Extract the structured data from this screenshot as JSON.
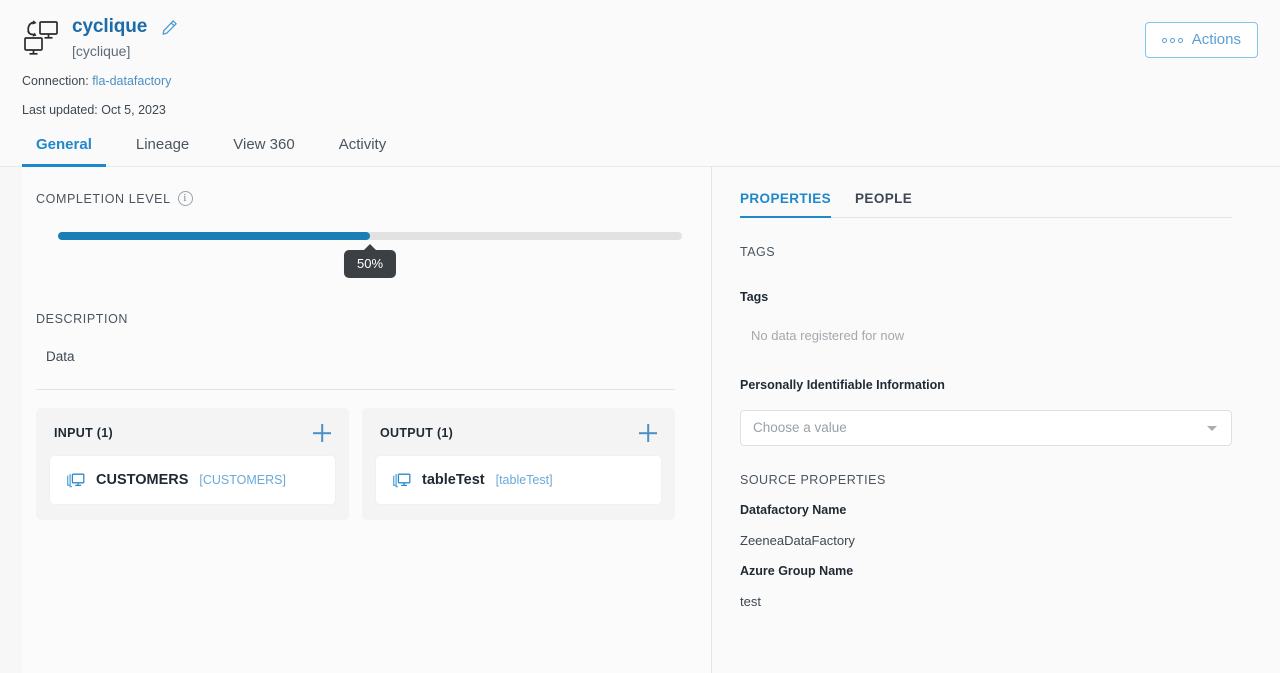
{
  "header": {
    "entity_icon": "data-process-screens-icon",
    "title": "cyclique",
    "subtitle": "[cyclique]",
    "edit_icon": "pencil-edit-icon",
    "actions_button": "Actions",
    "actions_icon": "three-dots-icon",
    "connection_label": "Connection:",
    "connection_value": "fla-datafactory",
    "last_updated_label": "Last updated:",
    "last_updated_value": "Oct 5, 2023"
  },
  "tabs": [
    {
      "label": "General",
      "active": true
    },
    {
      "label": "Lineage",
      "active": false
    },
    {
      "label": "View 360",
      "active": false
    },
    {
      "label": "Activity",
      "active": false
    }
  ],
  "main": {
    "completion": {
      "label": "COMPLETION LEVEL",
      "info_icon": "info-circle-icon",
      "percent": 50,
      "percent_label": "50%"
    },
    "description": {
      "label": "DESCRIPTION",
      "value": "Data"
    },
    "input": {
      "title": "INPUT (1)",
      "add_icon": "plus-icon",
      "items": [
        {
          "icon": "dataset-stack-icon",
          "name": "CUSTOMERS",
          "technical_name": "[CUSTOMERS]"
        }
      ]
    },
    "output": {
      "title": "OUTPUT (1)",
      "add_icon": "plus-icon",
      "items": [
        {
          "icon": "dataset-stack-icon",
          "name": "tableTest",
          "technical_name": "[tableTest]"
        }
      ]
    }
  },
  "right_panel": {
    "tabs": [
      {
        "label": "PROPERTIES",
        "active": true
      },
      {
        "label": "PEOPLE",
        "active": false
      }
    ],
    "tags_section_label": "TAGS",
    "tags_field_label": "Tags",
    "tags_empty_text": "No data registered for now",
    "pii_label": "Personally Identifiable Information",
    "pii_placeholder": "Choose a value",
    "pii_caret_icon": "chevron-down-icon",
    "source_properties_label": "SOURCE PROPERTIES",
    "source_properties": [
      {
        "key": "Datafactory Name",
        "value": "ZeeneaDataFactory"
      },
      {
        "key": "Azure Group Name",
        "value": "test"
      }
    ]
  },
  "colors": {
    "accent_blue": "#1e88cc",
    "title_blue": "#1b6ca8",
    "link_blue": "#4a90c4",
    "progress_fill": "#1a7fb5",
    "tooltip_bg": "#3c4044"
  }
}
